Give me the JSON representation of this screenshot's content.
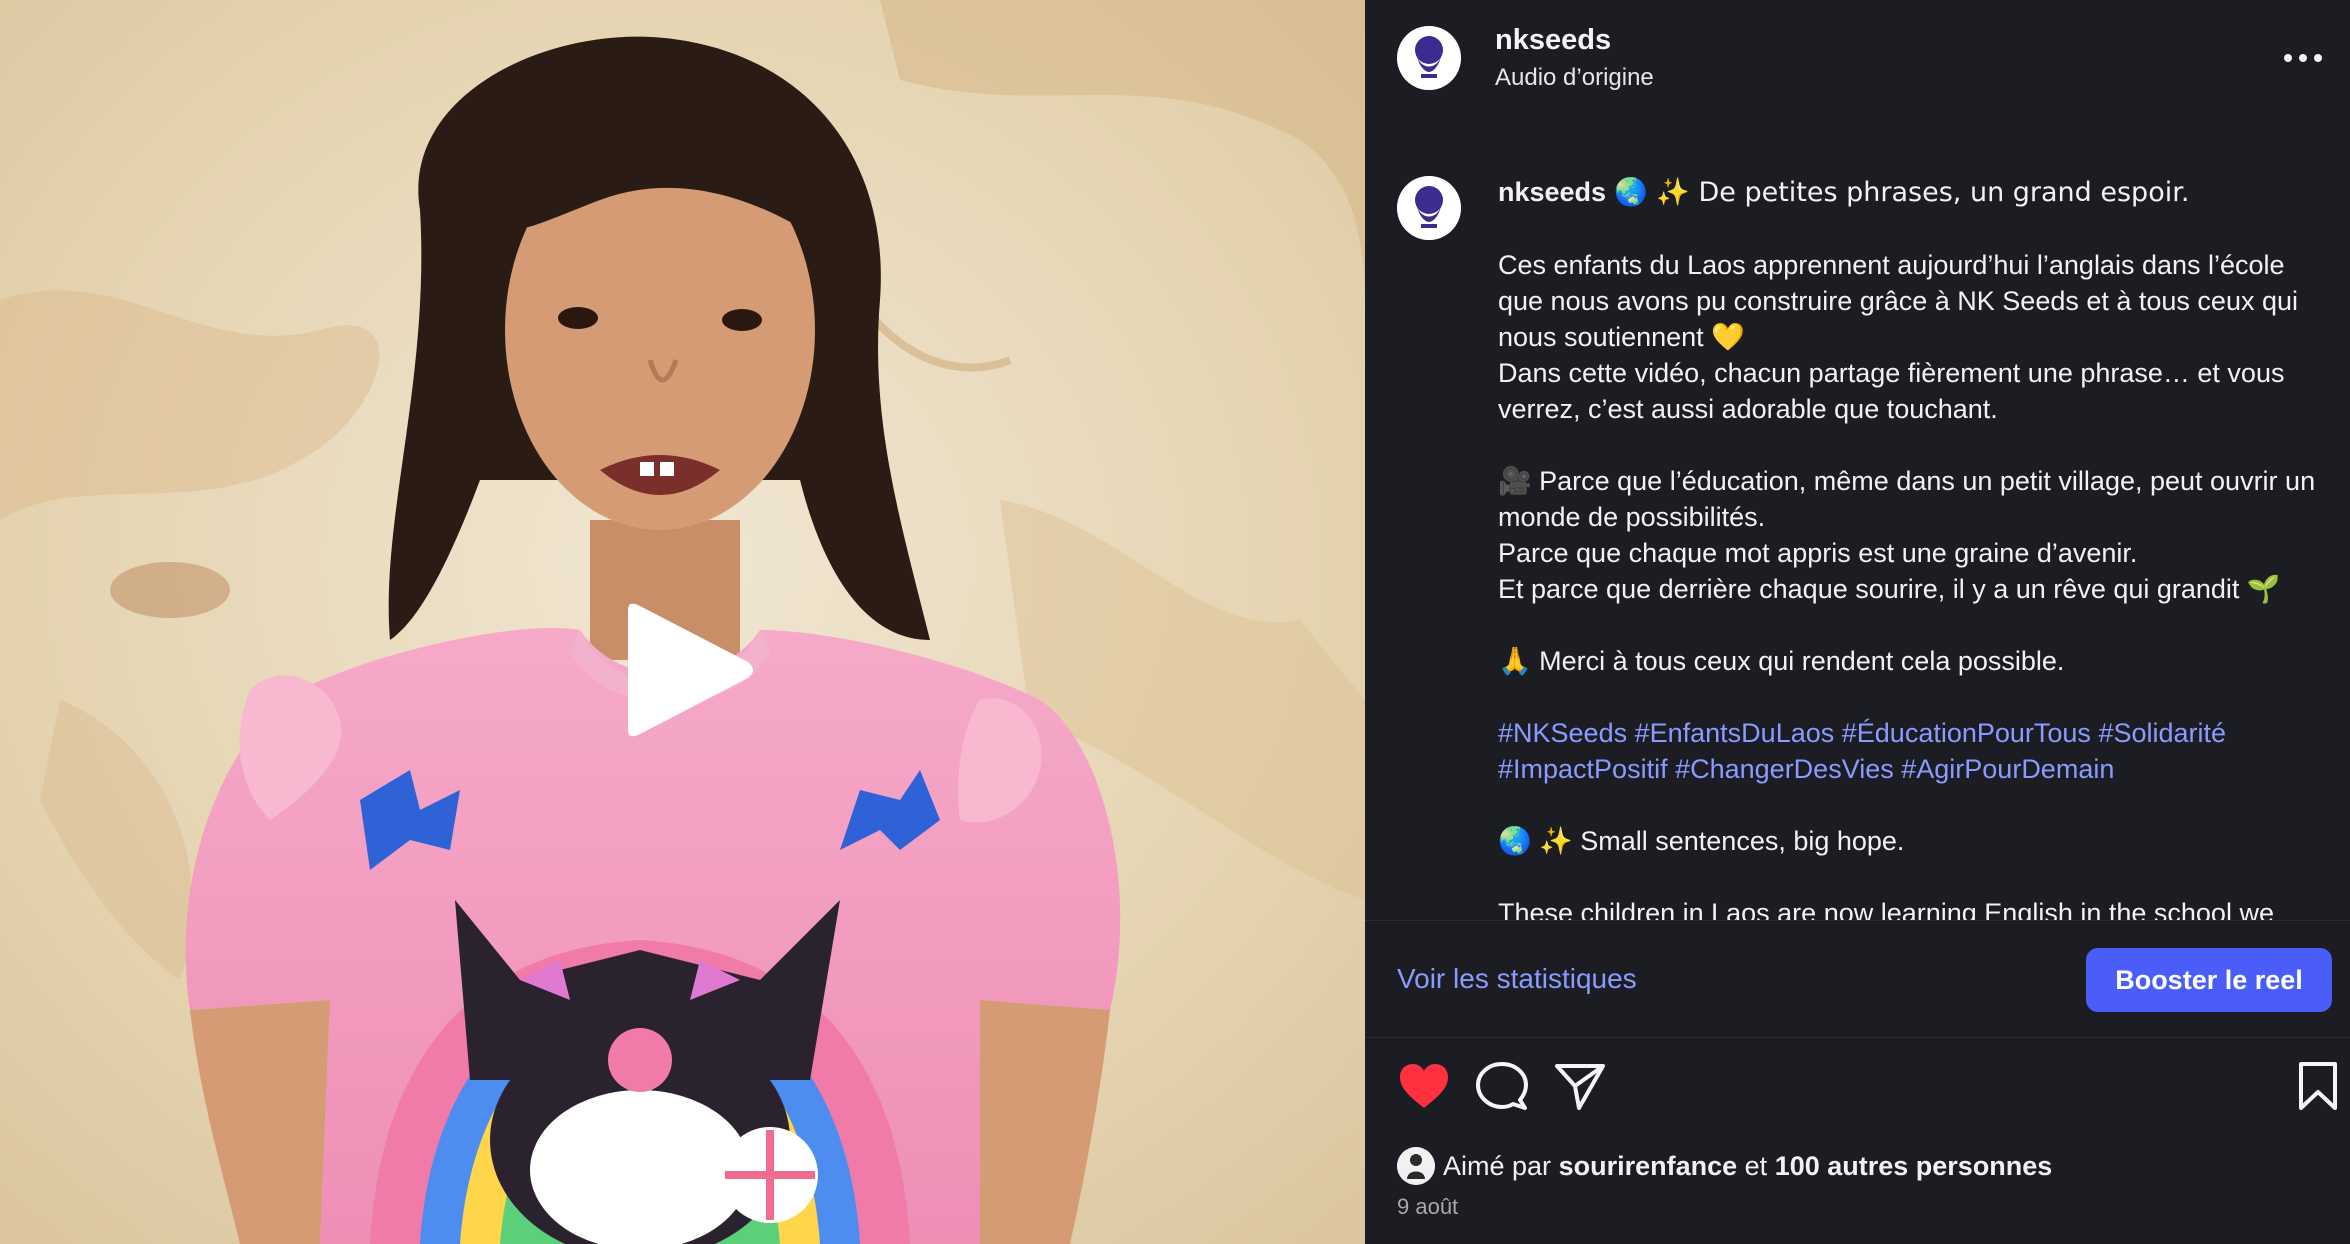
{
  "video": {
    "play_icon": "play-icon"
  },
  "header": {
    "username": "nkseeds",
    "audio_label": "Audio d’origine",
    "more_icon": "more-horizontal-icon"
  },
  "caption": {
    "username": "nkseeds",
    "line1": "🌏 ✨ De petites phrases, un grand espoir.",
    "para1": "Ces enfants du Laos apprennent aujourd’hui l’anglais dans l’école que nous avons pu construire grâce à NK Seeds et à tous ceux qui nous soutiennent 💛",
    "para2": "Dans cette vidéo, chacun partage fièrement une phrase… et vous verrez, c’est aussi adorable que touchant.",
    "para3": "🎥 Parce que l’éducation, même dans un petit village, peut ouvrir un monde de possibilités.",
    "para4": "Parce que chaque mot appris est une graine d’avenir.",
    "para5": "Et parce que derrière chaque sourire, il y a un rêve qui grandit 🌱",
    "para6": "🙏 Merci à tous ceux qui rendent cela possible.",
    "hashtags": [
      "#NKSeeds",
      "#EnfantsDuLaos",
      "#ÉducationPourTous",
      "#Solidarité",
      "#ImpactPositif",
      "#ChangerDesVies",
      "#AgirPourDemain"
    ],
    "english_line1": "🌏 ✨ Small sentences, big hope.",
    "english_para1": "These children in Laos are now learning English in the school we"
  },
  "stats": {
    "view_stats": "Voir les statistiques",
    "boost": "Booster le reel"
  },
  "actions": {
    "like_icon": "heart-filled-icon",
    "comment_icon": "comment-icon",
    "share_icon": "share-icon",
    "save_icon": "bookmark-icon",
    "like_color": "#ff3040"
  },
  "likes": {
    "prefix": "Aimé par",
    "user": "sourirenfance",
    "connector": "et",
    "others": "100 autres personnes"
  },
  "date": "9 août",
  "colors": {
    "panel_bg": "#1c1d22",
    "link": "#8a9bff",
    "button": "#4a5df9"
  }
}
